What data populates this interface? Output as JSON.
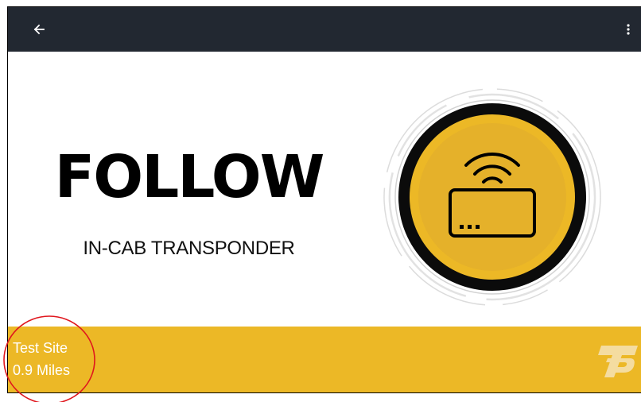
{
  "header": {
    "back_icon": "arrow-left-icon",
    "menu_icon": "more-vert-icon"
  },
  "main": {
    "title": "FOLLOW",
    "subtitle": "IN-CAB TRANSPONDER",
    "transponder_icon": "wireless-transponder-icon"
  },
  "footer": {
    "site_name": "Test Site",
    "distance": "0.9 Miles",
    "logo_icon": "brand-logo-icon"
  },
  "colors": {
    "topbar": "#222831",
    "accent": "#ecb826",
    "icon_ring": "#0b0b0b",
    "annotation": "#e0161d"
  }
}
